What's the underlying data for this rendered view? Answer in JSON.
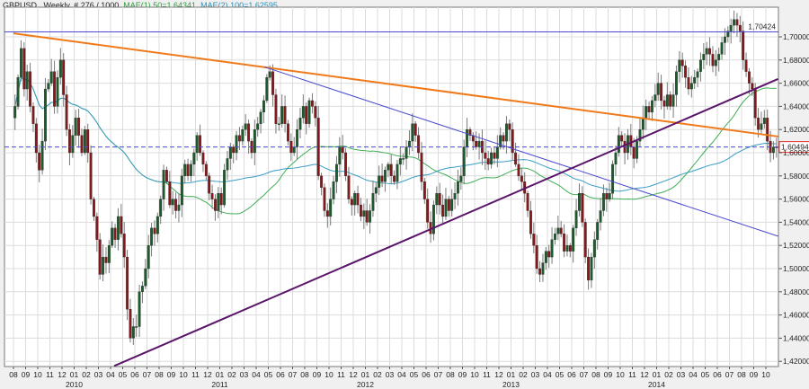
{
  "header": {
    "symbol_info": "GBPUSD , Weekly, # 276 / 1000,",
    "mae1": "MAE(1) 50=1,64341,",
    "mae2": "MAE(2) 100=1,62595"
  },
  "colors": {
    "bull": "#1e5b2c",
    "bear": "#86191c",
    "wick": "#7a7a7a",
    "ma50": "#3fae55",
    "ma100": "#3a9dc4",
    "orange_line": "#f07a1a",
    "purple_line": "#5a1469",
    "blue_line": "#4848d0",
    "grid": "#dcdcdc"
  },
  "chart_data": {
    "type": "candlestick",
    "title": "GBPUSD , Weekly",
    "start_month": "2009-08",
    "weeks_per_month": 4,
    "ylim": [
      1.405,
      1.725
    ],
    "yticks": [
      1.42,
      1.44,
      1.46,
      1.48,
      1.5,
      1.52,
      1.54,
      1.56,
      1.58,
      1.6,
      1.62,
      1.64,
      1.66,
      1.68,
      1.7
    ],
    "ytick_labels": [
      "1,42000",
      "1,44000",
      "1,46000",
      "1,48000",
      "1,50000",
      "1,52000",
      "1,54000",
      "1,56000",
      "1,58000",
      "1,60000",
      "1,62000",
      "1,64000",
      "1,66000",
      "1,68000",
      "1,70000"
    ],
    "month_labels": [
      "08",
      "09",
      "10",
      "11",
      "12",
      "01",
      "02",
      "03",
      "04",
      "05",
      "06",
      "07",
      "08",
      "09",
      "10",
      "11",
      "12",
      "01",
      "02",
      "03",
      "04",
      "05",
      "06",
      "07",
      "08",
      "09",
      "10",
      "11",
      "12",
      "01",
      "02",
      "03",
      "04",
      "05",
      "06",
      "07",
      "08",
      "09",
      "10",
      "11",
      "12",
      "01",
      "02",
      "03",
      "04",
      "05",
      "06",
      "07",
      "08",
      "09",
      "10",
      "11",
      "12",
      "01",
      "02",
      "03",
      "04",
      "05",
      "06",
      "07",
      "08",
      "09",
      "10"
    ],
    "year_labels": [
      {
        "label": "2010",
        "month_index": 5
      },
      {
        "label": "2011",
        "month_index": 17
      },
      {
        "label": "2012",
        "month_index": 29
      },
      {
        "label": "2013",
        "month_index": 41
      },
      {
        "label": "2014",
        "month_index": 53
      }
    ],
    "closes": [
      1.64,
      1.665,
      1.69,
      1.655,
      1.67,
      1.64,
      1.625,
      1.6,
      1.585,
      1.61,
      1.655,
      1.66,
      1.67,
      1.64,
      1.665,
      1.68,
      1.65,
      1.62,
      1.6,
      1.615,
      1.63,
      1.615,
      1.6,
      1.62,
      1.6,
      1.56,
      1.545,
      1.525,
      1.495,
      1.51,
      1.505,
      1.52,
      1.535,
      1.525,
      1.545,
      1.53,
      1.51,
      1.465,
      1.44,
      1.45,
      1.45,
      1.48,
      1.485,
      1.5,
      1.52,
      1.535,
      1.53,
      1.545,
      1.56,
      1.585,
      1.575,
      1.555,
      1.56,
      1.55,
      1.555,
      1.58,
      1.59,
      1.58,
      1.59,
      1.6,
      1.615,
      1.6,
      1.59,
      1.58,
      1.565,
      1.56,
      1.55,
      1.565,
      1.555,
      1.585,
      1.595,
      1.605,
      1.6,
      1.615,
      1.61,
      1.62,
      1.625,
      1.61,
      1.6,
      1.62,
      1.625,
      1.635,
      1.645,
      1.665,
      1.67,
      1.65,
      1.625,
      1.625,
      1.64,
      1.625,
      1.61,
      1.6,
      1.605,
      1.62,
      1.63,
      1.64,
      1.625,
      1.645,
      1.64,
      1.63,
      1.58,
      1.57,
      1.55,
      1.545,
      1.56,
      1.575,
      1.59,
      1.605,
      1.6,
      1.58,
      1.56,
      1.555,
      1.565,
      1.555,
      1.545,
      1.55,
      1.54,
      1.55,
      1.565,
      1.57,
      1.58,
      1.575,
      1.585,
      1.59,
      1.58,
      1.575,
      1.59,
      1.595,
      1.595,
      1.605,
      1.61,
      1.625,
      1.615,
      1.6,
      1.575,
      1.56,
      1.54,
      1.53,
      1.555,
      1.565,
      1.555,
      1.545,
      1.56,
      1.55,
      1.56,
      1.565,
      1.575,
      1.58,
      1.605,
      1.62,
      1.615,
      1.61,
      1.605,
      1.61,
      1.6,
      1.595,
      1.59,
      1.6,
      1.595,
      1.605,
      1.615,
      1.61,
      1.625,
      1.62,
      1.6,
      1.59,
      1.58,
      1.575,
      1.565,
      1.55,
      1.53,
      1.52,
      1.5,
      1.495,
      1.505,
      1.515,
      1.51,
      1.525,
      1.53,
      1.535,
      1.53,
      1.515,
      1.52,
      1.515,
      1.535,
      1.55,
      1.565,
      1.54,
      1.51,
      1.49,
      1.51,
      1.525,
      1.54,
      1.55,
      1.565,
      1.56,
      1.565,
      1.59,
      1.6,
      1.615,
      1.61,
      1.6,
      1.615,
      1.605,
      1.595,
      1.61,
      1.62,
      1.63,
      1.64,
      1.635,
      1.645,
      1.65,
      1.66,
      1.645,
      1.64,
      1.65,
      1.64,
      1.65,
      1.67,
      1.68,
      1.675,
      1.665,
      1.655,
      1.66,
      1.665,
      1.67,
      1.68,
      1.685,
      1.69,
      1.685,
      1.675,
      1.68,
      1.685,
      1.695,
      1.7,
      1.705,
      1.71,
      1.715,
      1.71,
      1.705,
      1.68,
      1.67,
      1.66,
      1.655,
      1.63,
      1.62,
      1.625,
      1.63,
      1.61,
      1.6,
      1.605,
      1.6049
    ],
    "moving_averages": [
      {
        "name": "MAE(1) 50",
        "period": 50,
        "last": 1.64341
      },
      {
        "name": "MAE(2) 100",
        "period": 100,
        "last": 1.62595
      }
    ],
    "trendlines": [
      {
        "name": "orange-resistance",
        "from": [
          0,
          1.703
        ],
        "to": [
          63,
          1.614
        ]
      },
      {
        "name": "blue-descending",
        "from": [
          20.7,
          1.674
        ],
        "to": [
          63,
          1.528
        ]
      },
      {
        "name": "purple-support",
        "from": [
          8.3,
          1.416
        ],
        "to": [
          63,
          1.6636
        ]
      }
    ],
    "horizontal_lines": [
      {
        "name": "level-1.70424",
        "value": 1.70424,
        "label": "1,70424",
        "style": "solid"
      },
      {
        "name": "current-price",
        "value": 1.60494,
        "label": "1,60494",
        "style": "dashed"
      }
    ]
  }
}
